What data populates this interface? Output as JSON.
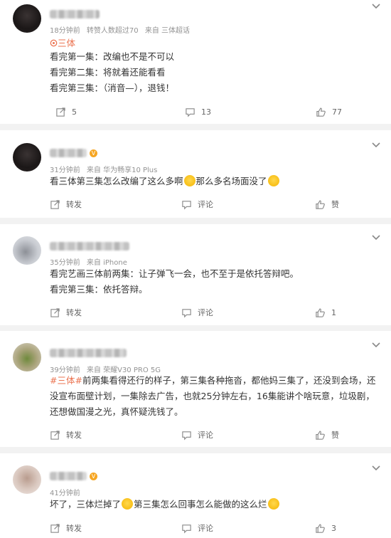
{
  "posts": [
    {
      "meta": [
        "18分钟前",
        "转赞人数超过70",
        "来自 三体超话"
      ],
      "super_topic": "三体",
      "lines": [
        "看完第一集：改编也不是不可以",
        "看完第二集：将就着还能看看",
        "看完第三集：（消音—），退钱！"
      ],
      "repost": "5",
      "comment": "13",
      "like": "77"
    },
    {
      "meta": [
        "31分钟前",
        "来自 华为畅享10 Plus"
      ],
      "text_a": "看三体第三集怎么改编了这么多啊",
      "text_b": "那么多名场面没了",
      "repost": "转发",
      "comment": "评论",
      "like": "赞"
    },
    {
      "meta": [
        "35分钟前",
        "来自 iPhone"
      ],
      "lines": [
        "看完艺画三体前两集：让子弹飞一会，也不至于是依托答辩吧。",
        "看完第三集：依托答辩。"
      ],
      "repost": "转发",
      "comment": "评论",
      "like": "1"
    },
    {
      "meta": [
        "39分钟前",
        "来自 荣耀V30 PRO 5G"
      ],
      "topic": "#三体#",
      "body": "前两集看得还行的样子，第三集各种拖沓，都他妈三集了，还没到会场，还没宣布面壁计划，一集除去广告，也就25分钟左右，16集能讲个啥玩意，垃圾剧，还想做国漫之光，真怀疑洗钱了。",
      "repost": "转发",
      "comment": "评论",
      "like": "赞"
    },
    {
      "meta": [
        "41分钟前"
      ],
      "text_a": "坏了，三体烂掉了",
      "text_b": "第三集怎么回事怎么能做的这么烂",
      "repost": "转发",
      "comment": "评论",
      "like": "3"
    }
  ],
  "colors": {
    "accent": "#eb7350",
    "meta": "#939393",
    "background": "#f2f2f2"
  },
  "icons": [
    "repost-icon",
    "comment-icon",
    "like-icon",
    "chevron-down-icon",
    "super-topic-icon",
    "emoji-icon"
  ]
}
